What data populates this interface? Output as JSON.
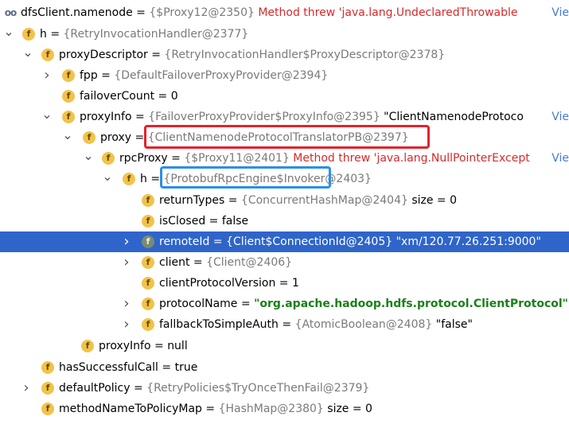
{
  "rows": [
    {
      "name": "dfsClient.namenode",
      "ref": "{$Proxy12@2350}",
      "extra": " Method threw 'java.lang.UndeclaredThrowable",
      "extra_color": "red",
      "link": "Vie",
      "icon": "oo",
      "arrow": ""
    },
    {
      "name": "h",
      "ref": "{RetryInvocationHandler@2377}",
      "extra": "",
      "arrow": "open"
    },
    {
      "name": "proxyDescriptor",
      "ref": "{RetryInvocationHandler$ProxyDescriptor@2378}",
      "extra": "",
      "arrow": "open"
    },
    {
      "name": "fpp",
      "ref": "{DefaultFailoverProxyProvider@2394}",
      "extra": "",
      "arrow": "closed"
    },
    {
      "name": "failoverCount",
      "value": "0",
      "arrow": ""
    },
    {
      "name": "proxyInfo",
      "ref": "{FailoverProxyProvider$ProxyInfo@2395}",
      "extra": " \"ClientNamenodeProtoco",
      "extra_color": "plain",
      "link": "Vie",
      "arrow": "open"
    },
    {
      "name": "proxy",
      "ref": "{ClientNamenodeProtocolTranslatorPB@2397}",
      "extra": "",
      "arrow": "open"
    },
    {
      "name": "rpcProxy",
      "ref": "{$Proxy11@2401}",
      "extra": " Method threw 'java.lang.NullPointerExcept",
      "extra_color": "red",
      "link": "Vie",
      "arrow": "open"
    },
    {
      "name": "h",
      "ref": "{ProtobufRpcEngine$Invoker@2403}",
      "extra": "",
      "arrow": "open"
    },
    {
      "name": "returnTypes",
      "ref": "{ConcurrentHashMap@2404}",
      "extra": "  size = 0",
      "extra_color": "plain",
      "arrow": ""
    },
    {
      "name": "isClosed",
      "value": "false",
      "arrow": ""
    },
    {
      "name": "remoteId",
      "ref": "{Client$ConnectionId@2405}",
      "extra": " \"xm/120.77.26.251:9000\"",
      "extra_color": "plain",
      "arrow": "closed",
      "selected": true
    },
    {
      "name": "client",
      "ref": "{Client@2406}",
      "extra": "",
      "arrow": "closed"
    },
    {
      "name": "clientProtocolVersion",
      "value": "1",
      "arrow": ""
    },
    {
      "name": "protocolName",
      "ref": "",
      "extra": "\"org.apache.hadoop.hdfs.protocol.ClientProtocol\"",
      "extra_color": "green",
      "arrow": "closed"
    },
    {
      "name": "fallbackToSimpleAuth",
      "ref": "{AtomicBoolean@2408}",
      "extra": " \"false\"",
      "extra_color": "plain",
      "arrow": "closed"
    },
    {
      "name": "proxyInfo",
      "value": "null",
      "arrow": ""
    },
    {
      "name": "hasSuccessfulCall",
      "value": "true",
      "arrow": ""
    },
    {
      "name": "defaultPolicy",
      "ref": "{RetryPolicies$TryOnceThenFail@2379}",
      "extra": "",
      "arrow": "closed"
    },
    {
      "name": "methodNameToPolicyMap",
      "ref": "{HashMap@2380}",
      "extra": "  size = 0",
      "extra_color": "plain",
      "arrow": ""
    }
  ],
  "icons": {
    "field": "f",
    "object": "oo"
  },
  "colors": {
    "selection": "#2f65ca",
    "highlight_red": "#e0242c",
    "highlight_blue": "#2b8fe8",
    "error": "#d62a2a",
    "string": "#1a7f1a",
    "ref": "#7a7a7a"
  }
}
